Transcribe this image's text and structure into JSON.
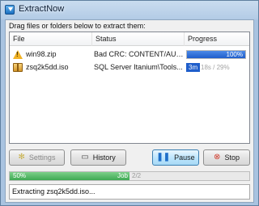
{
  "window": {
    "title": "ExtractNow"
  },
  "instructions": "Drag files or folders below to extract them:",
  "list": {
    "columns": [
      "File",
      "Status",
      "Progress"
    ],
    "rows": [
      {
        "icon": "warning-icon",
        "file": "win98.zip",
        "status": "Bad CRC: CONTENT/AUD...",
        "progress": {
          "fraction": 1.0,
          "label": "100%"
        }
      },
      {
        "icon": "archive-icon",
        "file": "zsq2k5dd.iso",
        "status": "SQL Server Itanium\\Tools...",
        "progress": {
          "fraction": 0.29,
          "elapsed": "3m",
          "remaining": "18s / 29%"
        }
      }
    ]
  },
  "buttons": {
    "settings": "Settings",
    "history": "History",
    "pause": "Pause",
    "stop": "Stop"
  },
  "overall": {
    "fraction": 0.5,
    "percent_label": "50%",
    "job_label": "Job",
    "job_count": "2/2"
  },
  "status_text": "Extracting zsq2k5dd.iso...",
  "colors": {
    "progress_blue": "#1f5ecb",
    "overall_green": "#3ea953",
    "warning": "#f2b325"
  }
}
